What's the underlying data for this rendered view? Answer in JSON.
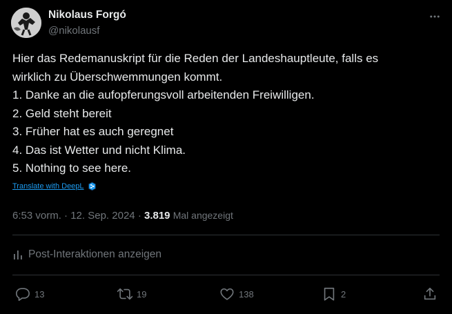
{
  "author": {
    "name": "Nikolaus Forgó",
    "handle": "@nikolausf"
  },
  "tweet": {
    "lines": [
      "Hier das Redemanuskript für die Reden der Landeshauptleute, falls es",
      "wirklich zu Überschwemmungen kommt.",
      "1. Danke an die aufopferungsvoll arbeitenden Freiwilligen.",
      "2. Geld steht bereit",
      "3. Früher hat es auch geregnet",
      "4. Das ist Wetter und nicht Klima.",
      "5. Nothing to see here."
    ],
    "translate_label": "Translate with DeepL"
  },
  "meta": {
    "time": "6:53 vorm.",
    "separator": "·",
    "date": "12. Sep. 2024",
    "views": "3.819",
    "views_label": "Mal angezeigt"
  },
  "engagements_label": "Post-Interaktionen anzeigen",
  "actions": {
    "replies": "13",
    "reposts": "19",
    "likes": "138",
    "bookmarks": "2"
  },
  "icons": {
    "more": "more-horizontal-icon",
    "deepl": "deepl-icon",
    "analytics": "analytics-bars-icon",
    "reply": "reply-icon",
    "repost": "repost-icon",
    "like": "heart-icon",
    "bookmark": "bookmark-icon",
    "share": "share-icon"
  },
  "colors": {
    "background": "#000000",
    "text": "#e7e9ea",
    "secondary": "#71767b",
    "link": "#1d9bf0",
    "divider": "#2f3336"
  }
}
